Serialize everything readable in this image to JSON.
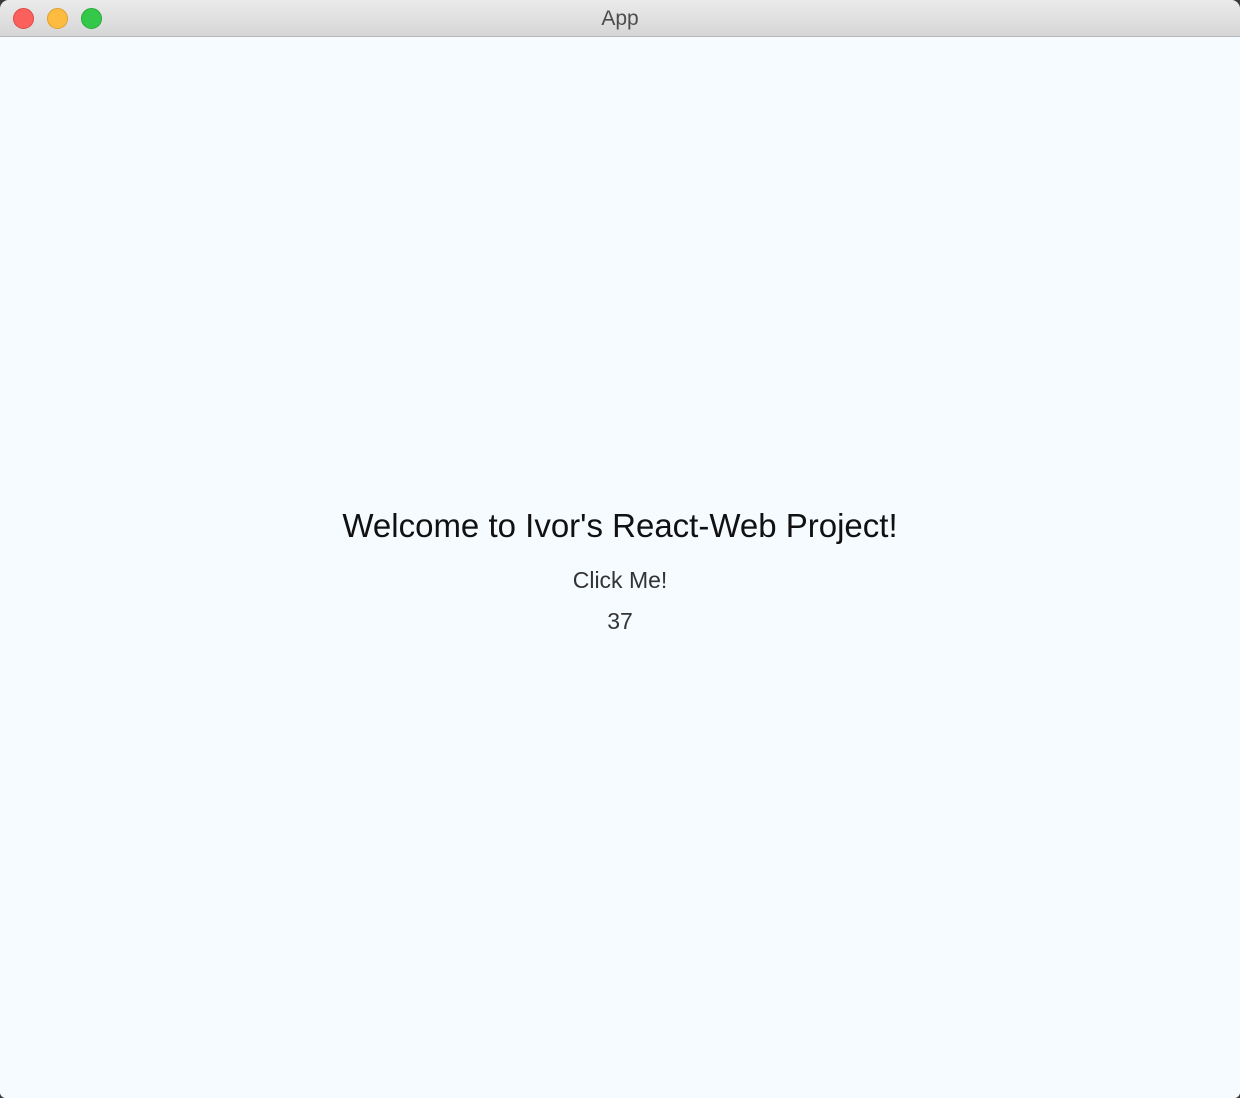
{
  "window": {
    "title": "App"
  },
  "main": {
    "heading": "Welcome to Ivor's React-Web Project!",
    "button_label": "Click Me!",
    "counter": "37"
  },
  "colors": {
    "background": "#f5fbff",
    "close": "#fc605c",
    "minimize": "#fdbc40",
    "maximize": "#34c84a"
  }
}
